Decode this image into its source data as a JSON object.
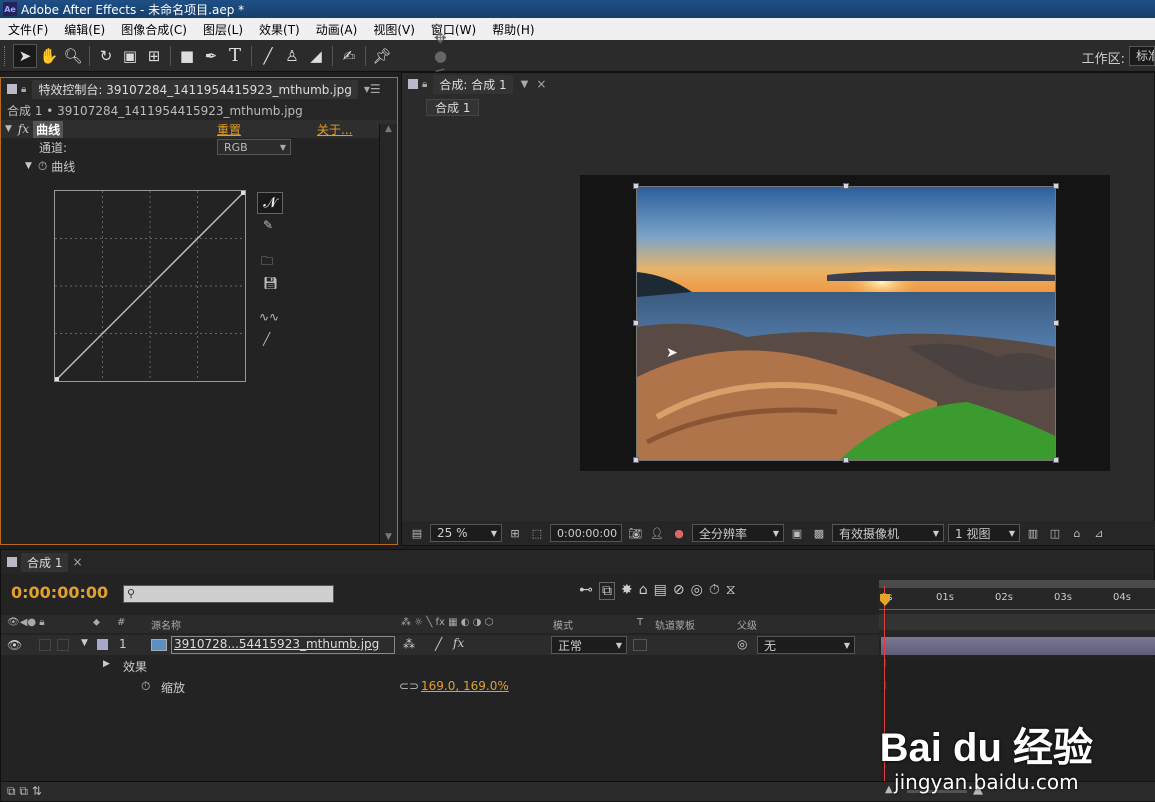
{
  "window": {
    "title": "Adobe After Effects - 未命名项目.aep *",
    "app_badge": "Ae"
  },
  "menu": [
    "文件(F)",
    "编辑(E)",
    "图像合成(C)",
    "图层(L)",
    "效果(T)",
    "动画(A)",
    "视图(V)",
    "窗口(W)",
    "帮助(H)"
  ],
  "toolbar": {
    "icons": [
      "selection-tool-icon",
      "hand-tool-icon",
      "zoom-tool-icon",
      "rotate-tool-icon",
      "camera-tool-icon",
      "pan-behind-tool-icon",
      "rectangle-tool-icon",
      "pen-tool-icon",
      "type-tool-icon",
      "brush-tool-icon",
      "clone-stamp-tool-icon",
      "eraser-tool-icon",
      "roto-brush-tool-icon",
      "puppet-pin-tool-icon"
    ],
    "workspace_label": "工作区:",
    "workspace_value": "标准"
  },
  "effects_panel": {
    "tab_label": "特效控制台: 39107284_1411954415923_mthumb.jpg",
    "subtitle": "合成 1 • 39107284_1411954415923_mthumb.jpg",
    "fx_badge": "fx",
    "effect_name": "曲线",
    "reset": "重置",
    "about": "关于...",
    "channel_label": "通道:",
    "channel_value": "RGB",
    "curves_label": "曲线"
  },
  "comp_panel": {
    "tab_label": "合成: 合成 1",
    "breadcrumb": "合成 1",
    "zoom": "25 %",
    "timecode": "0:00:00:00",
    "resolution": "全分辨率",
    "camera": "有效摄像机",
    "views": "1 视图"
  },
  "timeline": {
    "tab_label": "合成 1",
    "timecode": "0:00:00:00",
    "columns": {
      "num": "#",
      "source": "源名称",
      "mode": "模式",
      "t": "T",
      "trkmat": "轨道蒙板",
      "parent": "父级"
    },
    "layer": {
      "index": "1",
      "name": "3910728...54415923_mthumb.jpg",
      "mode": "正常",
      "parent": "无"
    },
    "effects_row": "效果",
    "scale_label": "缩放",
    "scale_value": "169.0, 169.0%",
    "ruler": [
      "0s",
      "01s",
      "02s",
      "03s",
      "04s"
    ]
  },
  "watermark": {
    "text": "Bai du 经验",
    "url": "jingyan.baidu.com"
  }
}
